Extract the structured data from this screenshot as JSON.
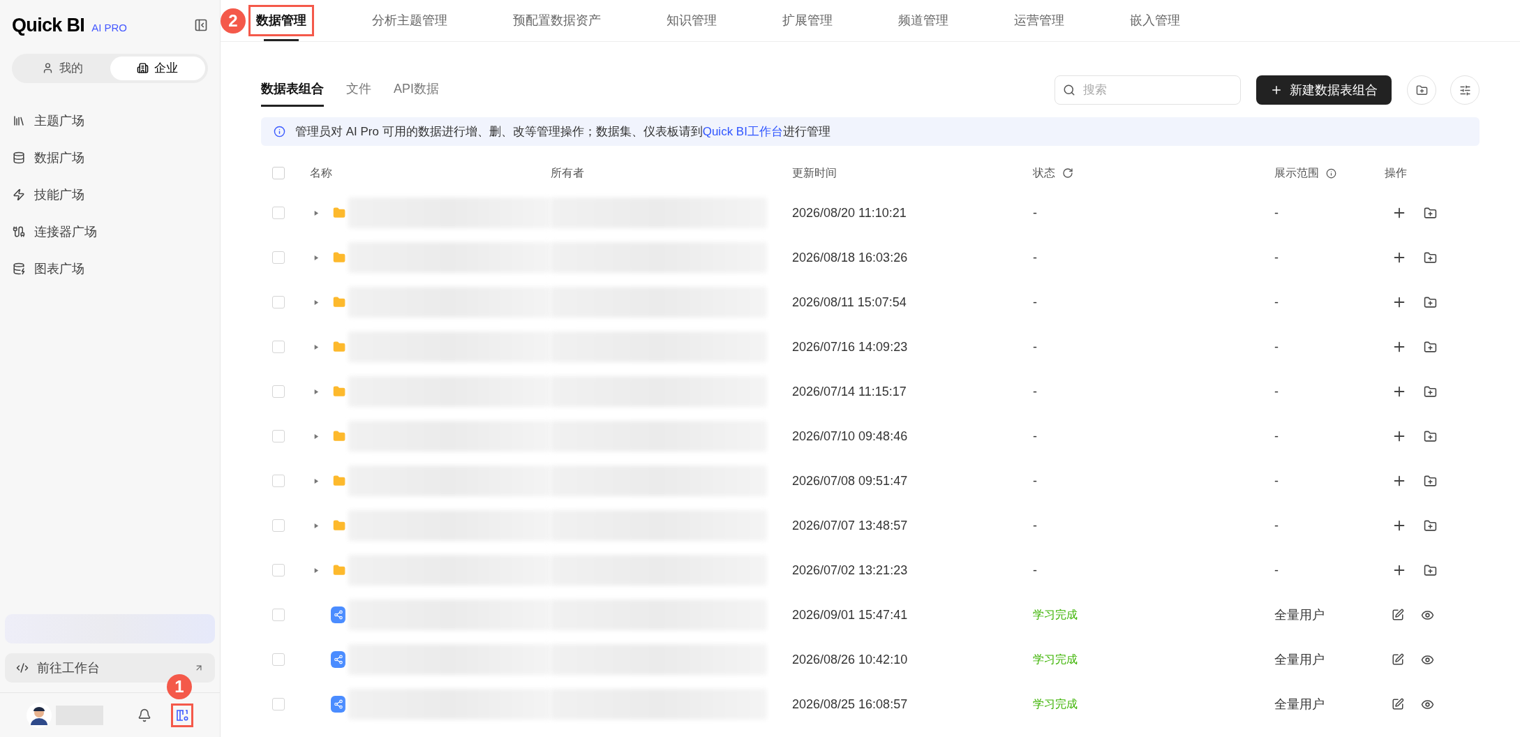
{
  "sidebar": {
    "brand": "Quick BI",
    "brand_badge": "AI PRO",
    "scope_toggle": [
      {
        "label": "我的",
        "selected": false
      },
      {
        "label": "企业",
        "selected": true
      }
    ],
    "items": [
      {
        "label": "主题广场"
      },
      {
        "label": "数据广场"
      },
      {
        "label": "技能广场"
      },
      {
        "label": "连接器广场"
      },
      {
        "label": "图表广场"
      }
    ],
    "workbench_button": "前往工作台"
  },
  "top_tabs": [
    {
      "label": "数据管理",
      "selected": true
    },
    {
      "label": "分析主题管理",
      "selected": false
    },
    {
      "label": "预配置数据资产",
      "selected": false
    },
    {
      "label": "知识管理",
      "selected": false
    },
    {
      "label": "扩展管理",
      "selected": false
    },
    {
      "label": "频道管理",
      "selected": false
    },
    {
      "label": "运营管理",
      "selected": false
    },
    {
      "label": "嵌入管理",
      "selected": false
    }
  ],
  "sub_tabs": [
    {
      "label": "数据表组合",
      "selected": true
    },
    {
      "label": "文件",
      "selected": false
    },
    {
      "label": "API数据",
      "selected": false
    }
  ],
  "toolbar": {
    "search": {
      "placeholder": "搜索"
    },
    "new_button": "新建数据表组合"
  },
  "notice": {
    "text": "管理员对 AI Pro 可用的数据进行增、删、改等管理操作；数据集、仪表板请到",
    "link": "Quick BI工作台",
    "text_after": "进行管理"
  },
  "table": {
    "select_all_checked": false,
    "columns": [
      "名称",
      "所有者",
      "更新时间",
      "状态",
      "展示范围",
      "操作"
    ],
    "rows": [
      {
        "kind": "folder",
        "checked": false,
        "updated": "2026/08/20 11:10:21",
        "status": "-",
        "scope": "-"
      },
      {
        "kind": "folder",
        "checked": false,
        "updated": "2026/08/18 16:03:26",
        "status": "-",
        "scope": "-"
      },
      {
        "kind": "folder",
        "checked": false,
        "updated": "2026/08/11 15:07:54",
        "status": "-",
        "scope": "-"
      },
      {
        "kind": "folder",
        "checked": false,
        "updated": "2026/07/16 14:09:23",
        "status": "-",
        "scope": "-"
      },
      {
        "kind": "folder",
        "checked": false,
        "updated": "2026/07/14 11:15:17",
        "status": "-",
        "scope": "-"
      },
      {
        "kind": "folder",
        "checked": false,
        "updated": "2026/07/10 09:48:46",
        "status": "-",
        "scope": "-"
      },
      {
        "kind": "folder",
        "checked": false,
        "updated": "2026/07/08 09:51:47",
        "status": "-",
        "scope": "-"
      },
      {
        "kind": "folder",
        "checked": false,
        "updated": "2026/07/07 13:48:57",
        "status": "-",
        "scope": "-"
      },
      {
        "kind": "folder",
        "checked": false,
        "updated": "2026/07/02 13:21:23",
        "status": "-",
        "scope": "-"
      },
      {
        "kind": "dataset",
        "checked": false,
        "updated": "2026/09/01 15:47:41",
        "status": "学习完成",
        "scope": "全量用户"
      },
      {
        "kind": "dataset",
        "checked": false,
        "updated": "2026/08/26 10:42:10",
        "status": "学习完成",
        "scope": "全量用户"
      },
      {
        "kind": "dataset",
        "checked": false,
        "updated": "2026/08/25 16:08:57",
        "status": "学习完成",
        "scope": "全量用户"
      }
    ]
  },
  "annotations": [
    {
      "label": "1"
    },
    {
      "label": "2"
    }
  ]
}
